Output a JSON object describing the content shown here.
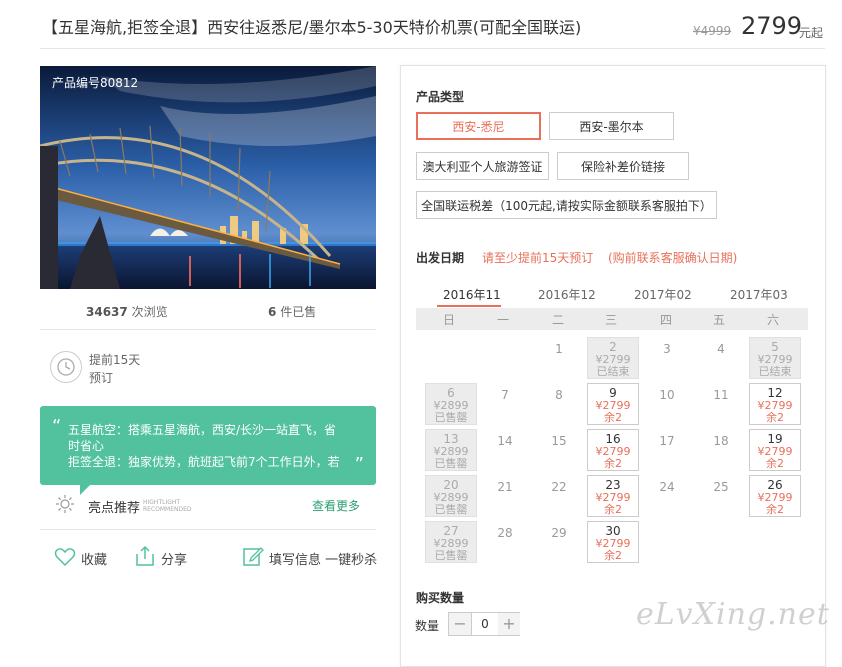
{
  "header": {
    "title": "【五星海航,拒签全退】西安往返悉尼/墨尔本5-30天特价机票(可配全国联运)",
    "old_price": "¥4999",
    "price": "2799",
    "price_unit": "元起"
  },
  "product": {
    "code_label": "产品编号80812",
    "views_count": "34637",
    "views_label": "次浏览",
    "sold_count": "6",
    "sold_label": "件已售",
    "advance_line1": "提前15天",
    "advance_line2": "预订"
  },
  "highlight": {
    "quote_line1": "五星航空：搭乘五星海航，西安/长沙一站直飞，省时省心",
    "quote_line2": "拒签全退：独家优势，航班起飞前7个工作日外，若",
    "title": "亮点推荐",
    "sub1": "HIGHTLIGHT",
    "sub2": "RECOMMENDED",
    "more": "查看更多"
  },
  "actions": {
    "favorite": "收藏",
    "share": "分享",
    "fill_info": "填写信息 一键秒杀"
  },
  "booking": {
    "type_title": "产品类型",
    "options": [
      "西安-悉尼",
      "西安-墨尔本",
      "澳大利亚个人旅游签证",
      "保险补差价链接",
      "全国联运税差（100元起,请按实际金额联系客服拍下）"
    ],
    "selected_option": 0,
    "date_title": "出发日期",
    "date_note1": "请至少提前15天预订",
    "date_note2": "(购前联系客服确认日期)",
    "months": [
      "2016年11",
      "2016年12",
      "2017年02",
      "2017年03"
    ],
    "selected_month": 0,
    "weekdays": [
      "日",
      "一",
      "二",
      "三",
      "四",
      "五",
      "六"
    ],
    "calendar": [
      [
        null,
        null,
        {
          "d": "1"
        },
        {
          "d": "2",
          "p": "¥2799",
          "s": "已结束",
          "t": "past"
        },
        {
          "d": "3"
        },
        {
          "d": "4"
        },
        {
          "d": "5",
          "p": "¥2799",
          "s": "已结束",
          "t": "past"
        }
      ],
      [
        {
          "d": "6",
          "p": "¥2899",
          "s": "已售罄",
          "t": "past"
        },
        {
          "d": "7"
        },
        {
          "d": "8"
        },
        {
          "d": "9",
          "p": "¥2799",
          "s": "余2",
          "t": "avail"
        },
        {
          "d": "10"
        },
        {
          "d": "11"
        },
        {
          "d": "12",
          "p": "¥2799",
          "s": "余2",
          "t": "avail"
        }
      ],
      [
        {
          "d": "13",
          "p": "¥2899",
          "s": "已售罄",
          "t": "past"
        },
        {
          "d": "14"
        },
        {
          "d": "15"
        },
        {
          "d": "16",
          "p": "¥2799",
          "s": "余2",
          "t": "avail"
        },
        {
          "d": "17"
        },
        {
          "d": "18"
        },
        {
          "d": "19",
          "p": "¥2799",
          "s": "余2",
          "t": "avail"
        }
      ],
      [
        {
          "d": "20",
          "p": "¥2899",
          "s": "已售罄",
          "t": "past"
        },
        {
          "d": "21"
        },
        {
          "d": "22"
        },
        {
          "d": "23",
          "p": "¥2799",
          "s": "余2",
          "t": "avail"
        },
        {
          "d": "24"
        },
        {
          "d": "25"
        },
        {
          "d": "26",
          "p": "¥2799",
          "s": "余2",
          "t": "avail"
        }
      ],
      [
        {
          "d": "27",
          "p": "¥2899",
          "s": "已售罄",
          "t": "past"
        },
        {
          "d": "28"
        },
        {
          "d": "29"
        },
        {
          "d": "30",
          "p": "¥2799",
          "s": "余2",
          "t": "avail"
        },
        null,
        null,
        null
      ]
    ],
    "qty_title": "购买数量",
    "qty_label": "数量",
    "qty_value": "0",
    "minus": "−",
    "plus": "+"
  },
  "watermark": "eLvXing.net",
  "colors": {
    "accent": "#e8705a",
    "green": "#52c19e",
    "link_green": "#2b9f72"
  }
}
